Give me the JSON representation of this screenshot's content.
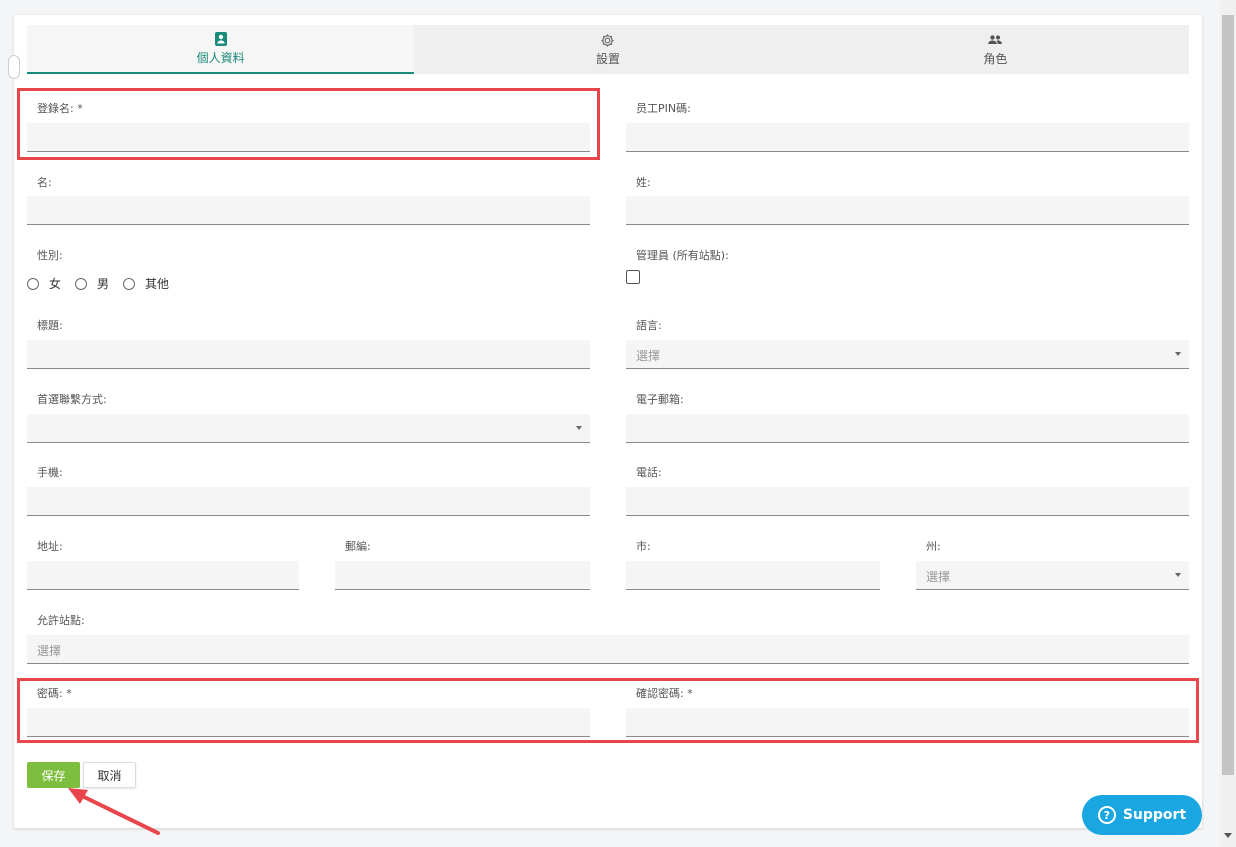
{
  "tabs": [
    {
      "label": "個人資料",
      "icon": "contact-card-icon",
      "active": true
    },
    {
      "label": "設置",
      "icon": "gear-icon",
      "active": false
    },
    {
      "label": "角色",
      "icon": "people-icon",
      "active": false
    }
  ],
  "fields": {
    "login_name": {
      "label": "登錄名: *",
      "value": ""
    },
    "employee_pin": {
      "label": "员工PIN碼:",
      "value": ""
    },
    "first_name": {
      "label": "名:",
      "value": ""
    },
    "last_name": {
      "label": "姓:",
      "value": ""
    },
    "gender": {
      "label": "性別:",
      "options": [
        "女",
        "男",
        "其他"
      ],
      "selected": null
    },
    "admin_all_sites": {
      "label": "管理員 (所有站點):",
      "checked": false
    },
    "title": {
      "label": "標題:",
      "value": ""
    },
    "language": {
      "label": "語言:",
      "placeholder": "選擇"
    },
    "preferred_contact": {
      "label": "首選聯繫方式:",
      "value": ""
    },
    "email": {
      "label": "電子郵箱:",
      "value": ""
    },
    "mobile": {
      "label": "手機:",
      "value": ""
    },
    "phone": {
      "label": "電話:",
      "value": ""
    },
    "address": {
      "label": "地址:",
      "value": ""
    },
    "postcode": {
      "label": "郵編:",
      "value": ""
    },
    "city": {
      "label": "市:",
      "value": ""
    },
    "state": {
      "label": "州:",
      "placeholder": "選擇"
    },
    "allowed_sites": {
      "label": "允許站點:",
      "placeholder": "選擇"
    },
    "password": {
      "label": "密碼: *",
      "value": ""
    },
    "confirm_password": {
      "label": "確認密碼: *",
      "value": ""
    }
  },
  "buttons": {
    "save": "保存",
    "cancel": "取消"
  },
  "support": {
    "label": "Support"
  },
  "colors": {
    "accent": "#1a8a7a",
    "save": "#7dbe3e",
    "highlight": "#e8464a",
    "support": "#1aa6e0"
  }
}
